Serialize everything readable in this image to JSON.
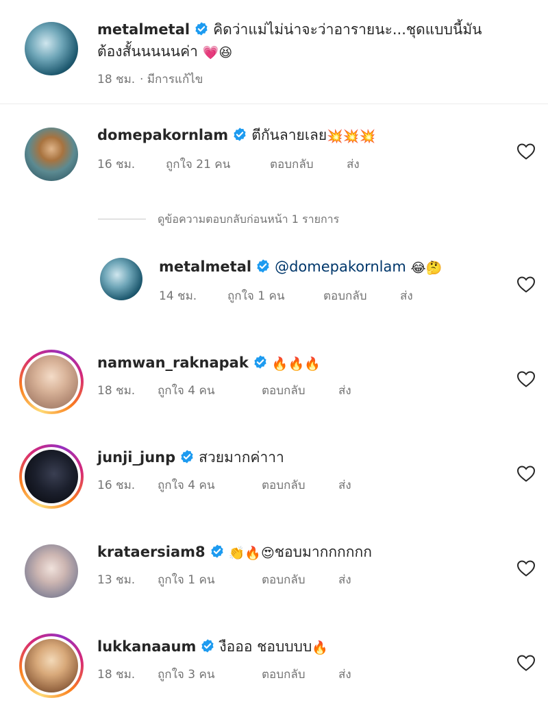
{
  "main_comment": {
    "username": "metalmetal",
    "text_line1": "คิดว่าแม่ไม่น่าจะว่าอารายนะ...ชุดแบบนี้มัน",
    "text_line2": "ต้องสั้นนนนนค่า",
    "emojis": [
      "💗",
      "😆"
    ],
    "time": "18 ชม.",
    "edited": "· มีการแก้ไข"
  },
  "comments": [
    {
      "username": "domepakornlam",
      "text": "ตีกันลายเลย",
      "emojis": "💥💥💥",
      "time": "16 ชม.",
      "likes": "ถูกใจ 21 คน",
      "reply": "ตอบกลับ",
      "send": "ส่ง"
    },
    {
      "username": "metalmetal",
      "text": "@domepakornlam",
      "emojis": "😂🤔",
      "time": "14 ชม.",
      "likes": "ถูกใจ 1 คน",
      "reply": "ตอบกลับ",
      "send": "ส่ง"
    },
    {
      "username": "namwan_raknapak",
      "text": "",
      "emojis": "🔥🔥🔥",
      "time": "18 ชม.",
      "likes": "ถูกใจ 4 คน",
      "reply": "ตอบกลับ",
      "send": "ส่ง"
    },
    {
      "username": "junji_junp",
      "text": "สวยมากค่าาา",
      "emojis": "",
      "time": "16 ชม.",
      "likes": "ถูกใจ 4 คน",
      "reply": "ตอบกลับ",
      "send": "ส่ง"
    },
    {
      "username": "krataersiam8",
      "text": "ชอบมากกกกกก",
      "emojis": "👏🔥😍",
      "time": "13 ชม.",
      "likes": "ถูกใจ 1 คน",
      "reply": "ตอบกลับ",
      "send": "ส่ง"
    },
    {
      "username": "lukkanaaum",
      "text": "งือออ ชอบบบบ",
      "emojis": "🔥",
      "time": "18 ชม.",
      "likes": "ถูกใจ 3 คน",
      "reply": "ตอบกลับ",
      "send": "ส่ง"
    }
  ],
  "view_previous_replies": "ดูข้อความตอบกลับก่อนหน้า 1 รายการ",
  "colors": {
    "verified": "#1d9bf0",
    "muted": "#737373",
    "text": "#262626",
    "mention": "#00376b"
  }
}
